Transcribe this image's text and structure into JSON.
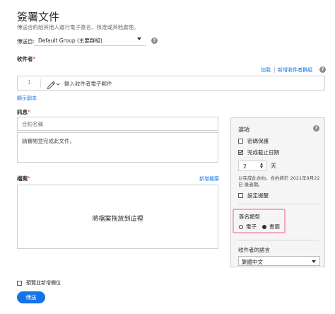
{
  "header": {
    "title": "簽署文件",
    "subtitle": "傳送合約給其他人進行電子簽名、核准或其他處理。"
  },
  "send_from": {
    "label": "傳送自:",
    "value": "Default Group (主要群組)"
  },
  "recipients": {
    "label": "收件者",
    "required_mark": "*",
    "add_me": "加我",
    "add_group": "新增收件者群組",
    "row_number": "1",
    "email_placeholder": "輸入收件者電子郵件",
    "show_cc": "顯示副本"
  },
  "message": {
    "label": "訊息",
    "required_mark": "*",
    "doc_name_placeholder": "合約名稱",
    "message_placeholder": "請審閱並完成此文件。"
  },
  "files": {
    "label": "檔案",
    "required_mark": "*",
    "add_files": "新增檔案",
    "drop_text": "將檔案拖放到這裡"
  },
  "options": {
    "title": "選項",
    "password_protect": "密碼保護",
    "completion_deadline": "完成截止日期",
    "deadline_checked": true,
    "days_value": "2",
    "days_label": "天",
    "expire_note": "以完成此合約，合約將於 2021年8月22日 後逾期。",
    "set_reminder": "設定提醒",
    "signature_type_title": "簽名類型",
    "signature_electronic": "電子",
    "signature_written": "書面",
    "signature_selected": "書面",
    "recipient_language_title": "收件者的語言",
    "language_value": "繁體中文"
  },
  "footer": {
    "preview_label": "預覽並新增欄位",
    "send_button": "傳送"
  },
  "colors": {
    "accent": "#1473e6",
    "highlight_border": "#f2a7c8",
    "required": "#d7373f"
  }
}
